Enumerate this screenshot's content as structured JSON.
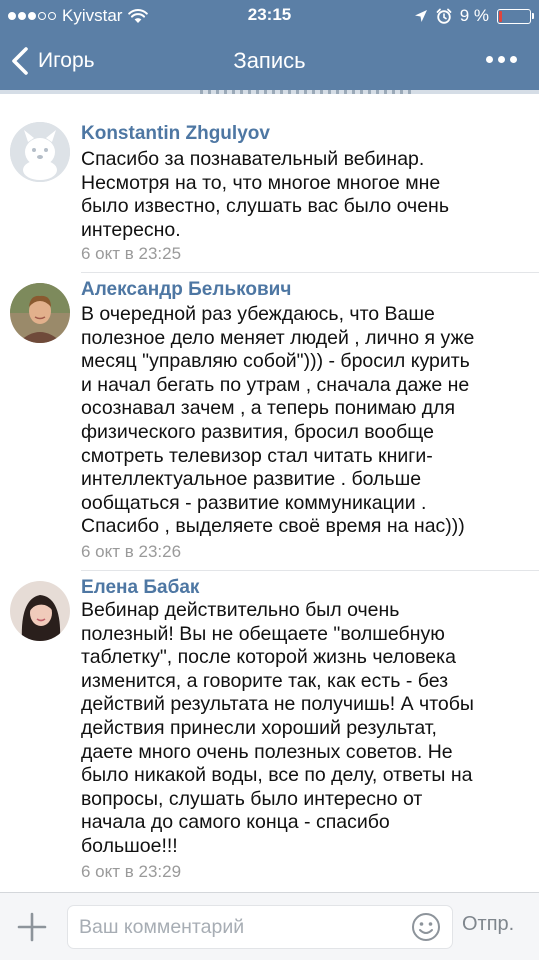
{
  "status_bar": {
    "carrier": "Kyivstar",
    "signal_bars_filled": 3,
    "signal_bars_total": 5,
    "time": "23:15",
    "battery_text": "9 %",
    "battery_level": 0.09,
    "battery_color": "#e0453c"
  },
  "nav": {
    "back_label": "Игорь",
    "title": "Запись"
  },
  "colors": {
    "header_bg": "#5b7fa6",
    "author_link": "#4e77a3",
    "timestamp": "#9a9a9a"
  },
  "comments": [
    {
      "author": "Konstantin Zhgulyov",
      "avatar": "dog-avatar",
      "lines": [
        "Спасибо за познавательный вебинар.",
        "Несмотря на то, что многое многое мне",
        "было известно, слушать вас было очень",
        "интересно."
      ],
      "time": "6 окт в 23:25"
    },
    {
      "author": "Александр Белькович",
      "avatar": "man-photo-avatar",
      "lines": [
        "В очередной раз убеждаюсь, что Ваше",
        "полезное дело меняет людей , лично я уже",
        "месяц \"управляю  собой\"))) - бросил курить",
        "и начал бегать по утрам , сначала даже не",
        "осознавал зачем , а теперь понимаю для",
        "физического развития, бросил вообще",
        "смотреть телевизор стал читать книги-",
        "интеллектуальное развитие . больше",
        "ообщаться - развитие коммуникации .",
        "Спасибо , выделяете своё время на нас)))"
      ],
      "time": "6 окт в 23:26"
    },
    {
      "author": "Елена Бабак",
      "avatar": "woman-photo-avatar",
      "lines": [
        "Вебинар действительно был очень",
        "полезный! Вы не обещаете \"волшебную",
        "таблетку\", после которой жизнь человека",
        "изменится, а говорите так, как есть - без",
        "действий результата не получишь! А чтобы",
        "действия принесли хороший результат,",
        "даете много очень полезных советов. Не",
        "было никакой воды, все по делу, ответы на",
        "вопросы, слушать было интересно от",
        "начала до самого конца - спасибо",
        "большое!!!"
      ],
      "time": "6 окт в 23:29"
    }
  ],
  "input_bar": {
    "placeholder": "Ваш комментарий",
    "value": "",
    "send_label": "Отпр."
  }
}
